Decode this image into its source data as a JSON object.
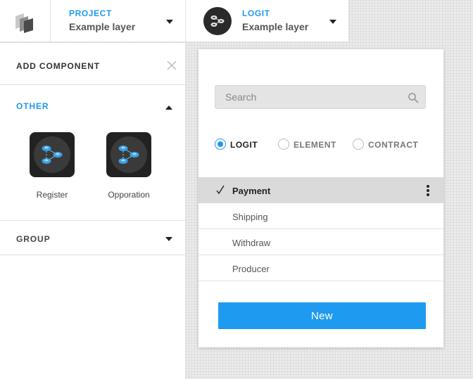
{
  "topbar": {
    "logo_icon": "cube-logo-icon",
    "project": {
      "kicker": "PROJECT",
      "value": "Example layer"
    },
    "logit": {
      "kicker": "LOGIT",
      "value": "Example layer",
      "icon": "network-nodes-icon"
    }
  },
  "panel": {
    "title": "ADD COMPONENT",
    "close_icon": "close-icon",
    "sections": {
      "other": {
        "label": "OTHER",
        "expanded": true,
        "components": [
          {
            "label": "Register",
            "icon": "network-nodes-icon"
          },
          {
            "label": "Opporation",
            "icon": "network-nodes-icon"
          }
        ]
      },
      "group": {
        "label": "GROUP",
        "expanded": false
      }
    }
  },
  "dropdown": {
    "search": {
      "placeholder": "Search",
      "value": ""
    },
    "filters": [
      {
        "label": "LOGIT",
        "checked": true
      },
      {
        "label": "ELEMENT",
        "checked": false
      },
      {
        "label": "CONTRACT",
        "checked": false
      }
    ],
    "items": [
      {
        "label": "Payment",
        "selected": true
      },
      {
        "label": "Shipping",
        "selected": false
      },
      {
        "label": "Withdraw",
        "selected": false
      },
      {
        "label": "Producer",
        "selected": false
      }
    ],
    "new_button": "New"
  },
  "colors": {
    "accent": "#1e9bf0",
    "selected_row": "#dadada",
    "icon_tile": "#222222",
    "node_blue": "#3aa0e6"
  }
}
